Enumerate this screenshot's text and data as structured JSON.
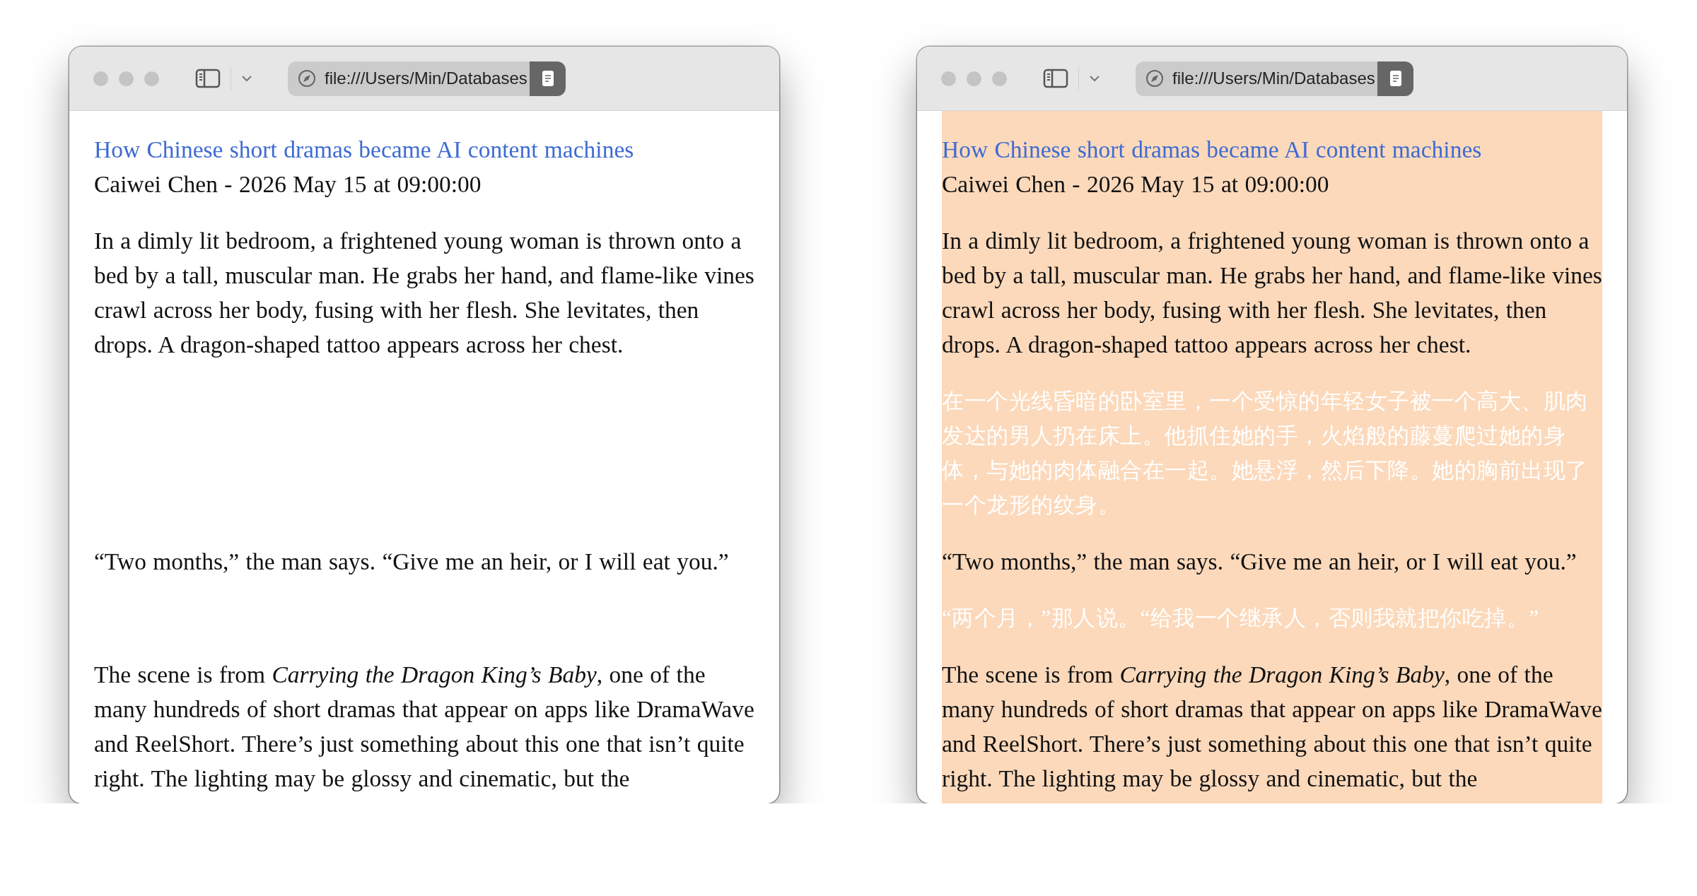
{
  "windows": [
    {
      "url": "file:///Users/Min/Databases",
      "highlighted": false,
      "title": "How Chinese short dramas became AI content machines",
      "byline": "Caiwei Chen - 2026 May 15 at 09:00:00",
      "blocks": [
        {
          "kind": "text",
          "text": "In a dimly lit bedroom, a frightened young woman is thrown onto a bed by a tall, muscular man. He grabs her hand, and flame-like vines crawl across her body, fusing with her flesh. She levitates, then drops. A dragon-shaped tattoo appears across her chest."
        },
        {
          "kind": "blank"
        },
        {
          "kind": "blank"
        },
        {
          "kind": "blank"
        },
        {
          "kind": "blank"
        },
        {
          "kind": "text",
          "text": "“Two months,” the man says. “Give me an heir, or I will eat you.”"
        },
        {
          "kind": "blank"
        },
        {
          "kind": "text",
          "text": "The scene is from *Carrying the Dragon King’s Baby*, one of the many hundreds of short dramas that appear on apps like DramaWave and ReelShort. There’s just something about this one that isn’t quite right. The lighting may be glossy and cinematic, but the"
        }
      ]
    },
    {
      "url": "file:///Users/Min/Databases",
      "highlighted": true,
      "title": "How Chinese short dramas became AI content machines",
      "byline": "Caiwei Chen - 2026 May 15 at 09:00:00",
      "blocks": [
        {
          "kind": "text",
          "text": "In a dimly lit bedroom, a frightened young woman is thrown onto a bed by a tall, muscular man. He grabs her hand, and flame-like vines crawl across her body, fusing with her flesh. She levitates, then drops. A dragon-shaped tattoo appears across her chest."
        },
        {
          "kind": "translation",
          "text": "在一个光线昏暗的卧室里，一个受惊的年轻女子被一个高大、肌肉发达的男人扔在床上。他抓住她的手，火焰般的藤蔓爬过她的身体，与她的肉体融合在一起。她悬浮，然后下降。她的胸前出现了一个龙形的纹身。"
        },
        {
          "kind": "text",
          "text": "“Two months,” the man says. “Give me an heir, or I will eat you.”"
        },
        {
          "kind": "translation",
          "text": "“两个月，”那人说。“给我一个继承人，否则我就把你吃掉。”"
        },
        {
          "kind": "text",
          "text": "The scene is from *Carrying the Dragon King’s Baby*, one of the many hundreds of short dramas that appear on apps like DramaWave and ReelShort. There’s just something about this one that isn’t quite right. The lighting may be glossy and cinematic, but the"
        }
      ]
    }
  ]
}
